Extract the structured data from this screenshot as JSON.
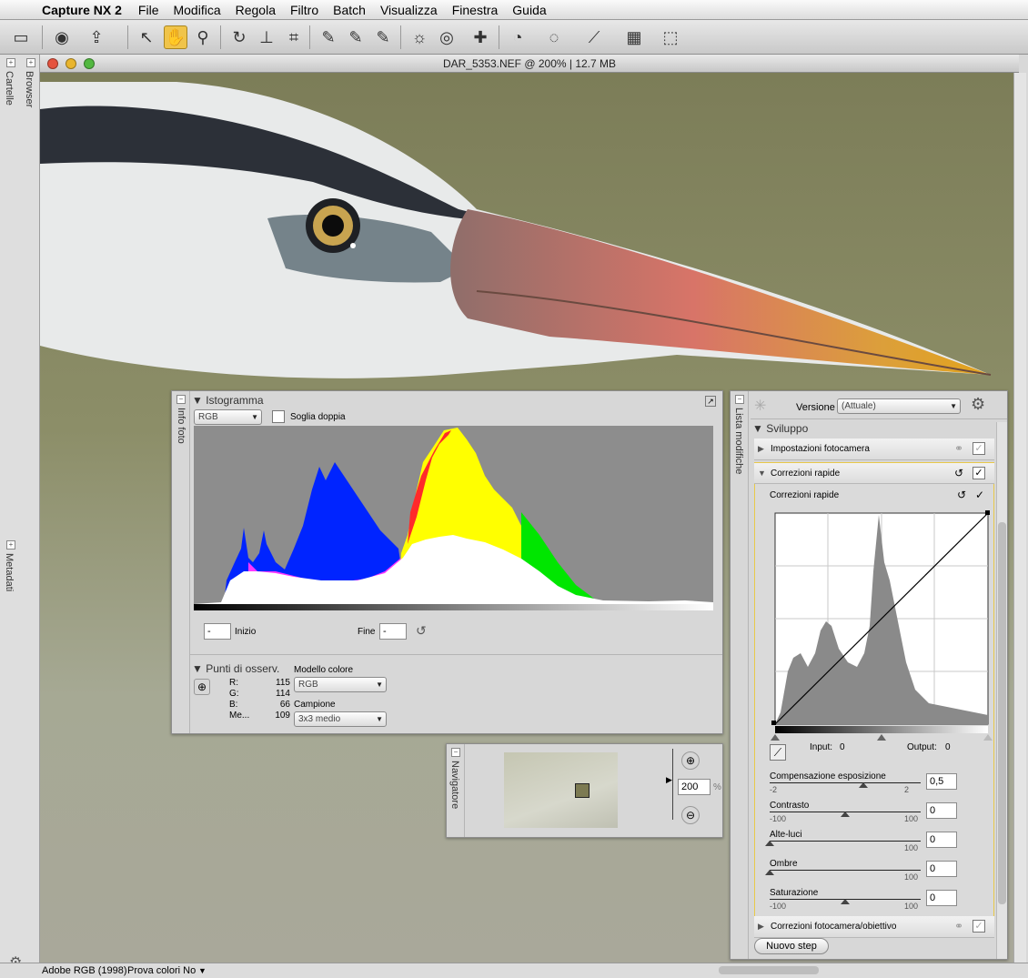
{
  "menubar": {
    "app": "Capture NX 2",
    "items": [
      "File",
      "Modifica",
      "Regola",
      "Filtro",
      "Batch",
      "Visualizza",
      "Finestra",
      "Guida"
    ]
  },
  "window": {
    "title": "DAR_5353.NEF @ 200% | 12.7 MB"
  },
  "left_panels": {
    "cartelle": "Cartelle",
    "browser": "Browser",
    "metadati": "Metadati"
  },
  "histogram_panel": {
    "side_label": "Info foto",
    "title": "Istogramma",
    "channel": "RGB",
    "dual_threshold": "Soglia doppia",
    "start_label": "Inizio",
    "start_value": "-",
    "end_label": "Fine",
    "end_value": "-",
    "watch_title": "Punti di osserv.",
    "color_model_label": "Modello colore",
    "color_model": "RGB",
    "sample_label": "Campione",
    "sample": "3x3 medio",
    "readout": [
      {
        "k": "R:",
        "v": "115"
      },
      {
        "k": "G:",
        "v": "114"
      },
      {
        "k": "B:",
        "v": "66"
      },
      {
        "k": "Me...",
        "v": "109"
      }
    ]
  },
  "navigator": {
    "label": "Navigatore",
    "zoom": "200",
    "unit": "%"
  },
  "edit_list": {
    "side_label": "Lista modifiche",
    "version_label": "Versione",
    "version_value": "(Attuale)",
    "group": "Sviluppo",
    "camera_settings": "Impostazioni fotocamera",
    "quick_fix": "Correzioni rapide",
    "quick_fix_sub": "Correzioni rapide",
    "input_label": "Input:",
    "input_value": "0",
    "output_label": "Output:",
    "output_value": "0",
    "sliders": [
      {
        "label": "Compensazione esposizione",
        "min": "-2",
        "max": "2",
        "value": "0,5",
        "pos": 0.62
      },
      {
        "label": "Contrasto",
        "min": "-100",
        "max": "100",
        "value": "0",
        "pos": 0.5
      },
      {
        "label": "Alte-luci",
        "min": "",
        "max": "100",
        "value": "0",
        "pos": 0.0
      },
      {
        "label": "Ombre",
        "min": "",
        "max": "100",
        "value": "0",
        "pos": 0.0
      },
      {
        "label": "Saturazione",
        "min": "-100",
        "max": "100",
        "value": "0",
        "pos": 0.5
      }
    ],
    "lens_corrections": "Correzioni fotocamera/obiettivo",
    "new_step": "Nuovo step"
  },
  "statusbar": {
    "profile": "Adobe RGB (1998)",
    "proof": "Prova colori No"
  }
}
